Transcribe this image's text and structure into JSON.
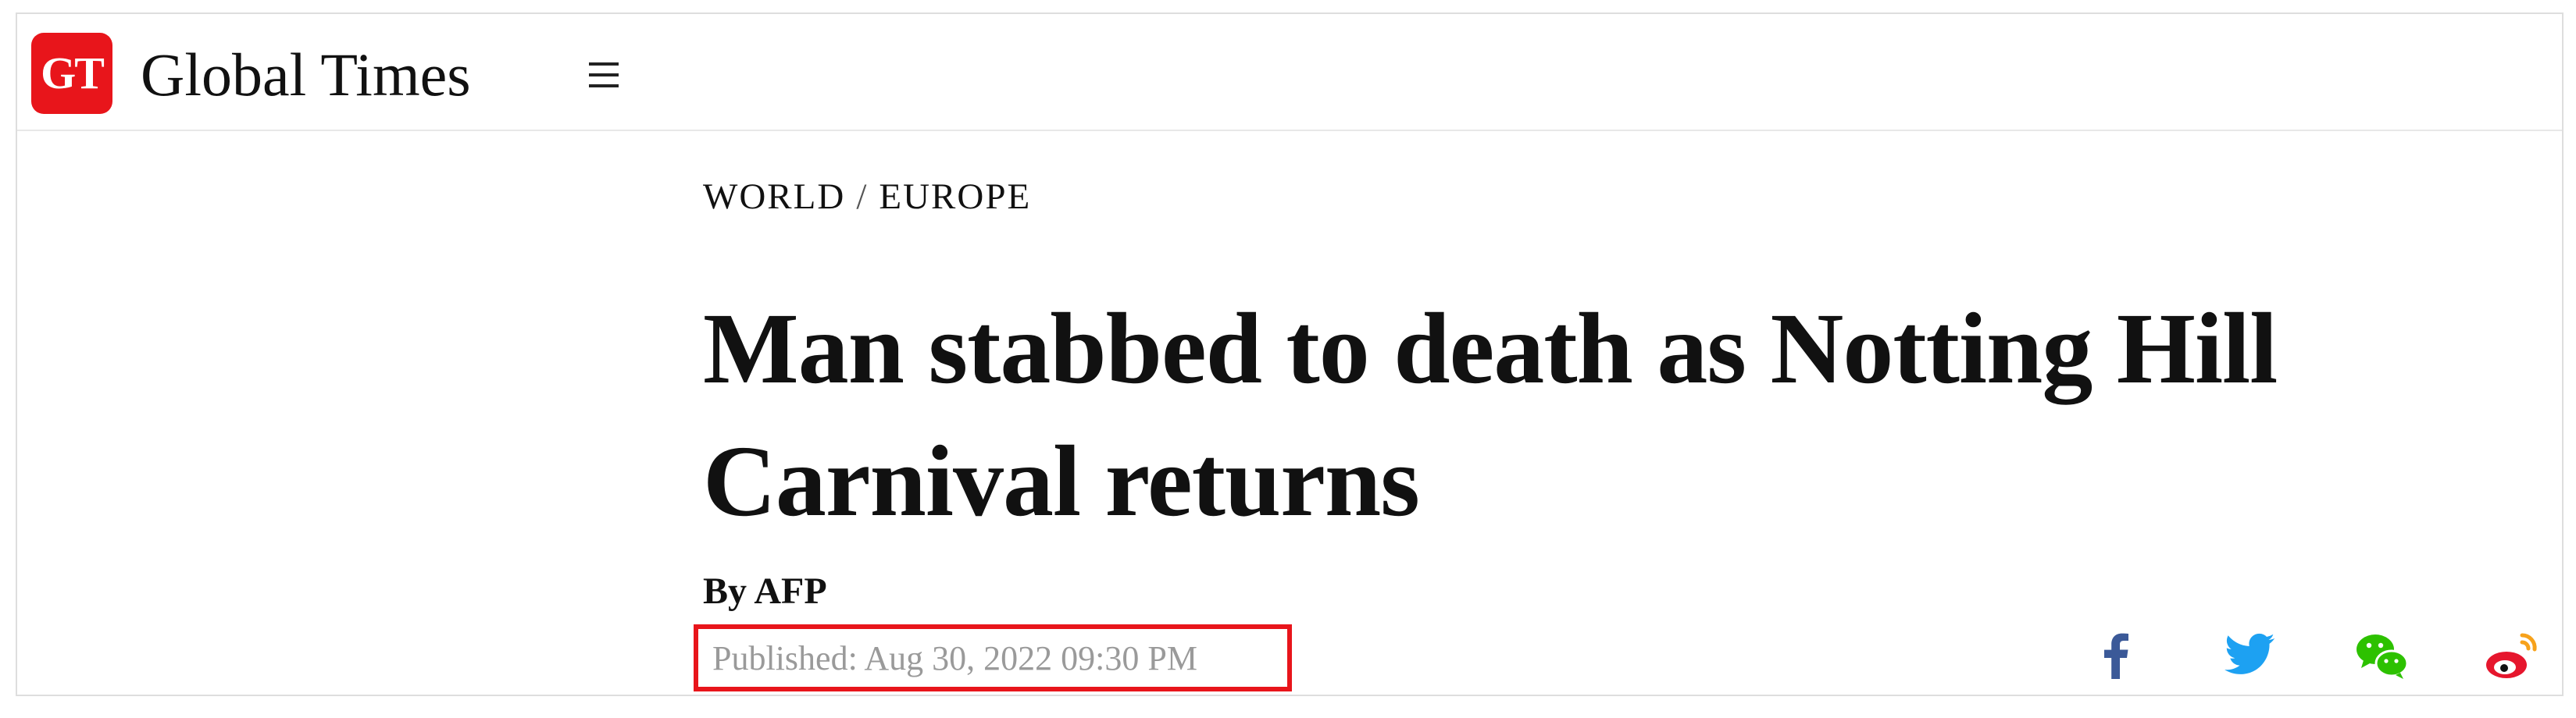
{
  "header": {
    "logo_badge": "GT",
    "logo_text": "Global Times",
    "menu_icon": "hamburger-menu-icon"
  },
  "article": {
    "section": "WORLD",
    "subsection": "EUROPE",
    "separator": "/",
    "headline": "Man stabbed to death as Notting Hill Carnival returns",
    "byline": "By AFP",
    "published": "Published: Aug 30, 2022 09:30 PM"
  },
  "share": {
    "icons": [
      "facebook-icon",
      "twitter-icon",
      "wechat-icon",
      "weibo-icon"
    ]
  },
  "colors": {
    "brand_red": "#e8151b",
    "facebook_blue": "#3b5998",
    "twitter_blue": "#1da1f2",
    "wechat_green": "#2dc100",
    "weibo_red": "#e6162d",
    "published_gray": "#9a9a9a"
  }
}
